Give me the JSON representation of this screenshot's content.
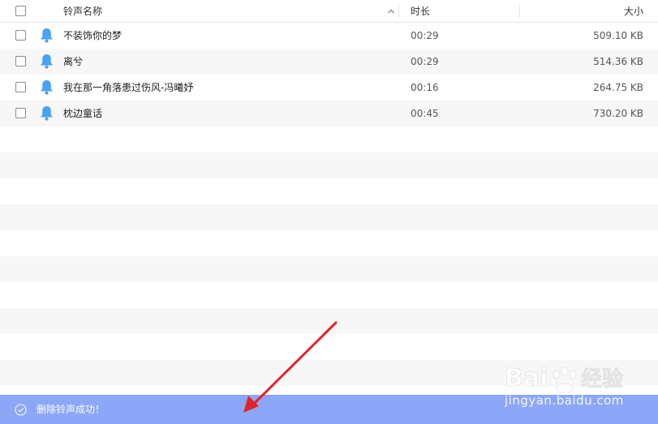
{
  "header": {
    "col_name": "铃声名称",
    "col_duration": "时长",
    "col_size": "大小"
  },
  "ringtones": [
    {
      "name": "不装饰你的梦",
      "duration": "00:29",
      "size": "509.10 KB"
    },
    {
      "name": "离兮",
      "duration": "00:29",
      "size": "514.36 KB"
    },
    {
      "name": "我在那一角落患过伤风-冯曦妤",
      "duration": "00:16",
      "size": "264.75 KB"
    },
    {
      "name": "枕边童话",
      "duration": "00:45",
      "size": "730.20 KB"
    }
  ],
  "status_bar": {
    "message": "删除铃声成功！"
  },
  "icons": {
    "select_all": "checkbox-icon",
    "sort": "chevron-up-icon",
    "row_icon": "bell-icon",
    "status": "check-circle-icon"
  },
  "colors": {
    "bell": "#4aa3f0",
    "status_bar": "#8ca7f7",
    "stripe": "#f7f7f7",
    "annotation_arrow": "#e3232c"
  },
  "watermark": {
    "brand_a": "Bai",
    "brand_b": "经验",
    "domain": "jingyan.baidu.com"
  }
}
